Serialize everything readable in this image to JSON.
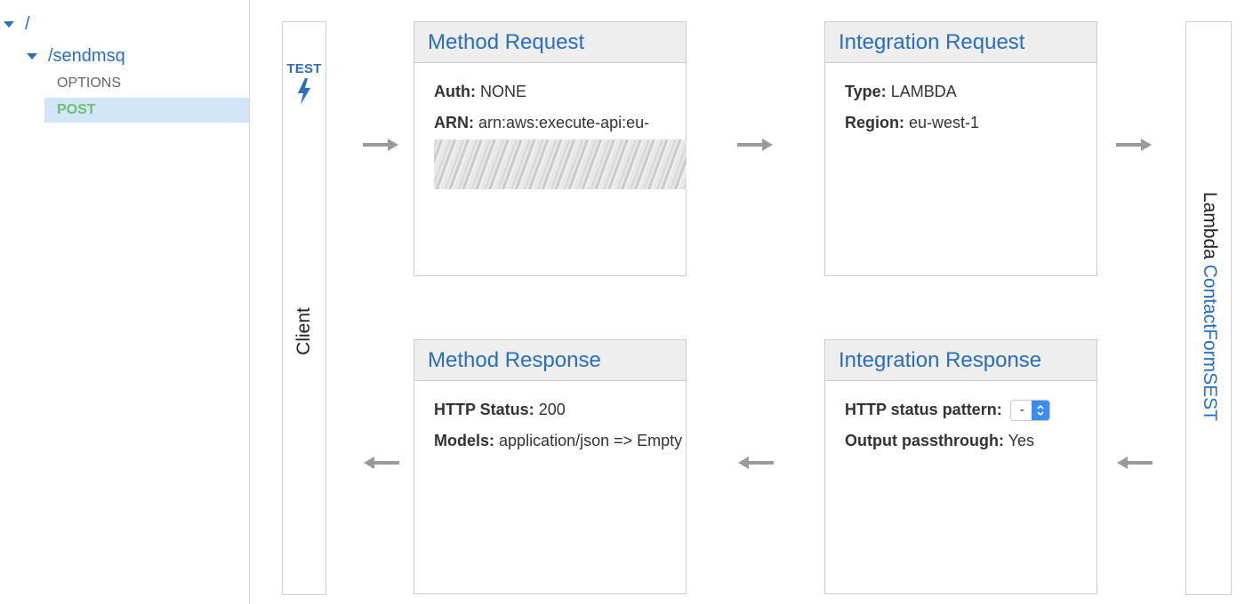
{
  "sidebar": {
    "root_label": "/",
    "resource_label": "/sendmsq",
    "methods": [
      "OPTIONS",
      "POST"
    ]
  },
  "client": {
    "test_label": "TEST",
    "label": "Client"
  },
  "lambda": {
    "prefix": "Lambda",
    "function_name": "ContactFormSEST"
  },
  "method_request": {
    "title": "Method Request",
    "auth_label": "Auth:",
    "auth_value": "NONE",
    "arn_label": "ARN:",
    "arn_value": "arn:aws:execute-api:eu-"
  },
  "integration_request": {
    "title": "Integration Request",
    "type_label": "Type:",
    "type_value": "LAMBDA",
    "region_label": "Region:",
    "region_value": "eu-west-1"
  },
  "method_response": {
    "title": "Method Response",
    "status_label": "HTTP Status:",
    "status_value": "200",
    "models_label": "Models:",
    "models_value": "application/json => Empty"
  },
  "integration_response": {
    "title": "Integration Response",
    "pattern_label": "HTTP status pattern:",
    "pattern_value": "-",
    "passthrough_label": "Output passthrough:",
    "passthrough_value": "Yes"
  },
  "colors": {
    "link_blue": "#2a6ebb",
    "post_green": "#6cbf71",
    "selected_bg": "#d2e6f8",
    "arrow_gray": "#9a9a9a",
    "header_bg": "#eeeeee"
  }
}
